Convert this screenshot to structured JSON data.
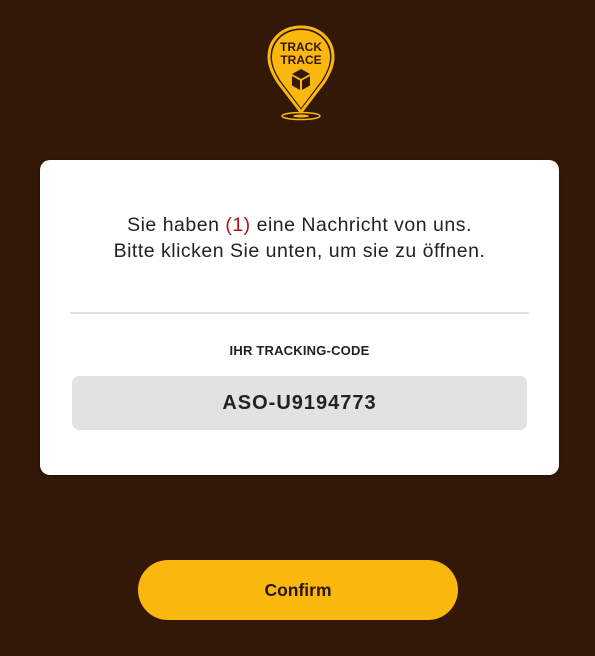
{
  "logo": {
    "line1": "TRACK",
    "line2": "TRACE",
    "icon": "map-pin-package-icon",
    "color": "#fab80f"
  },
  "card": {
    "message": {
      "before_count": "Sie haben ",
      "count": "(1)",
      "after_count": " eine Nachricht von uns.",
      "line2": "Bitte klicken Sie unten, um sie zu öffnen."
    },
    "code_label": "IHR TRACKING-CODE",
    "code_value": "ASO-U9194773"
  },
  "confirm_label": "Confirm",
  "colors": {
    "background": "#341807",
    "accent": "#fab80f",
    "count_red": "#b3101c"
  }
}
